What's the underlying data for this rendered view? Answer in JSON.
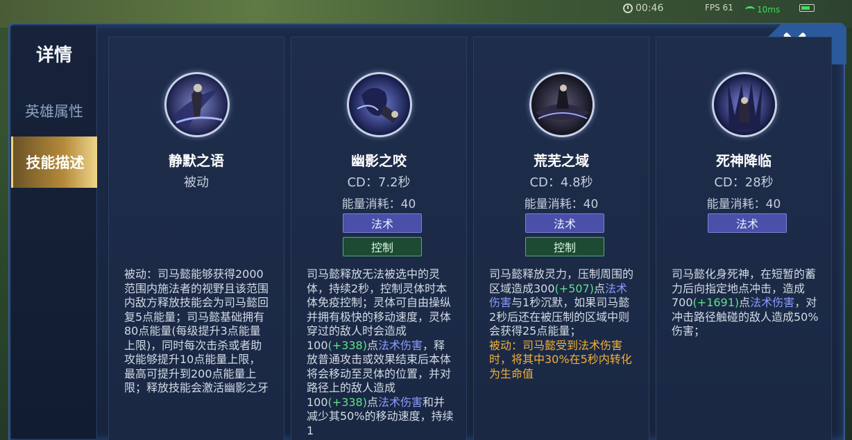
{
  "hud": {
    "timer": "00:46",
    "fps": "FPS 61",
    "ping": "10ms"
  },
  "sidebar": {
    "title": "详情",
    "tabs": [
      {
        "label": "英雄属性",
        "active": false
      },
      {
        "label": "技能描述",
        "active": true
      }
    ]
  },
  "skills": [
    {
      "name": "静默之语",
      "subtitle": "被动",
      "cost": "",
      "tags": [],
      "description": [
        {
          "t": "被动：司马懿能够获得2000范围内施法者的视野且该范围内敌方释放技能会为司马懿回复5点能量；司马懿基础拥有80点能量(每级提升3点能量上限)，同时每次击杀或者助攻能够提升10点能量上限，最高可提升到200点能量上限；释放技能会激活幽影之牙",
          "c": ""
        }
      ]
    },
    {
      "name": "幽影之咬",
      "subtitle": "CD：7.2秒",
      "cost": "能量消耗：40",
      "tags": [
        "法术",
        "控制"
      ],
      "description": [
        {
          "t": "司马懿释放无法被选中的灵体，持续2秒，控制灵体时本体免疫控制；灵体可自由操纵并拥有极快的移动速度，灵体穿过的敌人时会造成100",
          "c": ""
        },
        {
          "t": "(+338)",
          "c": "g"
        },
        {
          "t": "点",
          "c": ""
        },
        {
          "t": "法术伤害",
          "c": "b"
        },
        {
          "t": "，释放普通攻击或效果结束后本体将会移动至灵体的位置，并对路径上的敌人造成100",
          "c": ""
        },
        {
          "t": "(+338)",
          "c": "g"
        },
        {
          "t": "点",
          "c": ""
        },
        {
          "t": "法术伤害",
          "c": "b"
        },
        {
          "t": "和并减少其50%的移动速度，持续1",
          "c": ""
        }
      ]
    },
    {
      "name": "荒芜之域",
      "subtitle": "CD：4.8秒",
      "cost": "能量消耗：40",
      "tags": [
        "法术",
        "控制"
      ],
      "description": [
        {
          "t": "司马懿释放灵力，压制周围的区域造成300",
          "c": ""
        },
        {
          "t": "(+507)",
          "c": "g"
        },
        {
          "t": "点",
          "c": ""
        },
        {
          "t": "法术伤害",
          "c": "b"
        },
        {
          "t": "与1秒沉默，如果司马懿2秒后还在被压制的区域中则会获得25点能量；",
          "c": ""
        },
        {
          "t": "被动：司马懿受到法术伤害时，将其中30%在5秒内转化为生命值",
          "c": "o",
          "block": true
        }
      ]
    },
    {
      "name": "死神降临",
      "subtitle": "CD：28秒",
      "cost": "能量消耗：40",
      "tags": [
        "法术"
      ],
      "description": [
        {
          "t": "司马懿化身死神，在短暂的蓄力后向指定地点冲击，造成700",
          "c": ""
        },
        {
          "t": "(+1691)",
          "c": "g"
        },
        {
          "t": "点",
          "c": ""
        },
        {
          "t": "法术伤害",
          "c": "b"
        },
        {
          "t": "，对冲击路径触碰的敌人造成50%伤害；",
          "c": ""
        }
      ]
    }
  ]
}
